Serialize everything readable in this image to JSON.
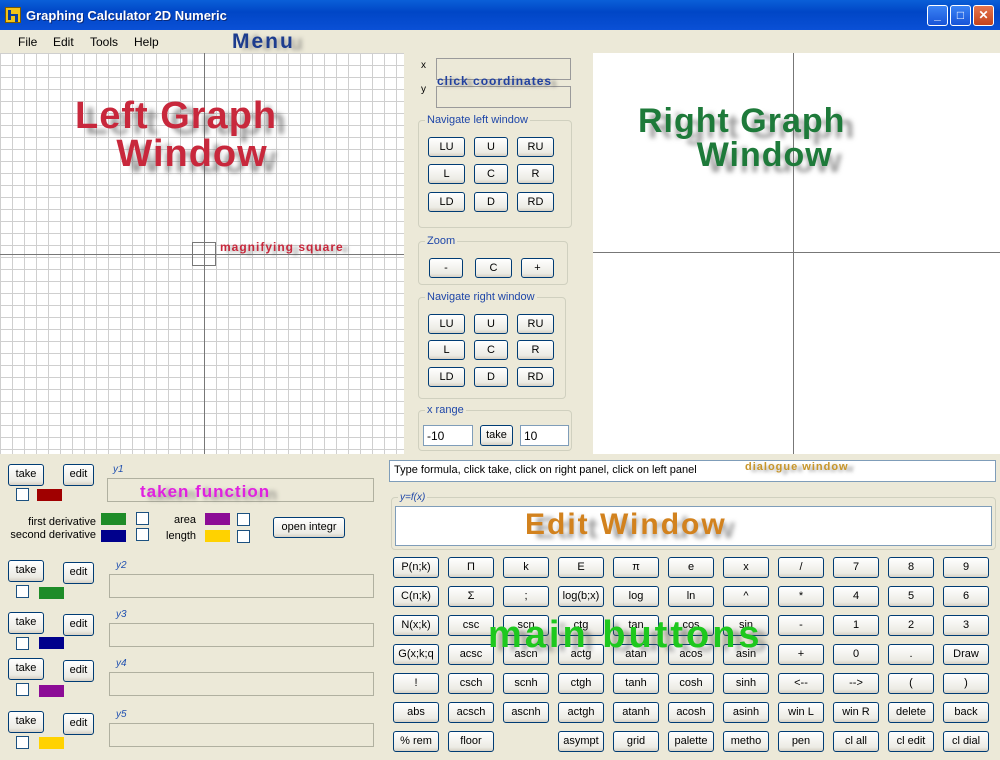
{
  "window": {
    "title": "Graphing Calculator 2D Numeric",
    "minimize_glyph": "_",
    "maximize_glyph": "□",
    "close_glyph": "✕"
  },
  "menu": [
    "File",
    "Edit",
    "Tools",
    "Help"
  ],
  "annotations": {
    "menu": "Menu",
    "left_graph": [
      "Left Graph",
      "Window"
    ],
    "right_graph": [
      "Right Graph",
      "Window"
    ],
    "magnifying": "magnifying square",
    "click_coordinates": "click coordinates",
    "dialogue": "dialogue window",
    "edit_window": "Edit Window",
    "main_buttons": "main buttons",
    "taken_function": "taken function"
  },
  "coordinates": {
    "x_label": "x",
    "y_label": "y"
  },
  "nav_left": {
    "legend": "Navigate left window",
    "buttons": [
      "LU",
      "U",
      "RU",
      "L",
      "C",
      "R",
      "LD",
      "D",
      "RD"
    ]
  },
  "zoom": {
    "legend": "Zoom",
    "buttons": [
      "-",
      "C",
      "+"
    ]
  },
  "nav_right": {
    "legend": "Navigate right window",
    "buttons": [
      "LU",
      "U",
      "RU",
      "L",
      "C",
      "R",
      "LD",
      "D",
      "RD"
    ]
  },
  "x_range": {
    "legend": "x range",
    "min": "-10",
    "max": "10",
    "take_label": "take"
  },
  "functions": [
    {
      "label": "y1",
      "take": "take",
      "edit": "edit",
      "color": "#a00000"
    },
    {
      "label": "y2",
      "take": "take",
      "edit": "edit",
      "color": "#1e8c28"
    },
    {
      "label": "y3",
      "take": "take",
      "edit": "edit",
      "color": "#00008c"
    },
    {
      "label": "y4",
      "take": "take",
      "edit": "edit",
      "color": "#8c0c96"
    },
    {
      "label": "y5",
      "take": "take",
      "edit": "edit",
      "color": "#ffd200"
    }
  ],
  "derivatives": {
    "first": "first derivative",
    "second": "second derivative",
    "area": "area",
    "length": "length",
    "first_color": "#1e8c28",
    "second_color": "#00008c",
    "area_color": "#8c0c96",
    "length_color": "#ffd200",
    "open_integr": "open integr"
  },
  "dialogue": {
    "text": "Type formula, click take, click on right panel, click on left panel"
  },
  "edit_window": {
    "label": "y=f(x)"
  },
  "main_buttons": [
    [
      "P(n;k)",
      "Π",
      "k",
      "E",
      "π",
      "e",
      "x",
      "/",
      "7",
      "8",
      "9"
    ],
    [
      "C(n;k)",
      "Σ",
      ";",
      "log(b;x)",
      "log",
      "ln",
      "^",
      "*",
      "4",
      "5",
      "6"
    ],
    [
      "N(x;k)",
      "csc",
      "scn",
      "ctg",
      "tan",
      "cos",
      "sin",
      "-",
      "1",
      "2",
      "3"
    ],
    [
      "G(x;k;q",
      "acsc",
      "ascn",
      "actg",
      "atan",
      "acos",
      "asin",
      "+",
      "0",
      ".",
      "Draw"
    ],
    [
      "!",
      "csch",
      "scnh",
      "ctgh",
      "tanh",
      "cosh",
      "sinh",
      "<--",
      "-->",
      "(",
      ")"
    ],
    [
      "abs",
      "acsch",
      "ascnh",
      "actgh",
      "atanh",
      "acosh",
      "asinh",
      "win L",
      "win R",
      "delete",
      "back"
    ],
    [
      "% rem",
      "floor",
      "",
      "",
      "asympt",
      "grid",
      "palette",
      "metho",
      "pen",
      "cl all",
      "cl edit",
      "cl dial"
    ]
  ]
}
